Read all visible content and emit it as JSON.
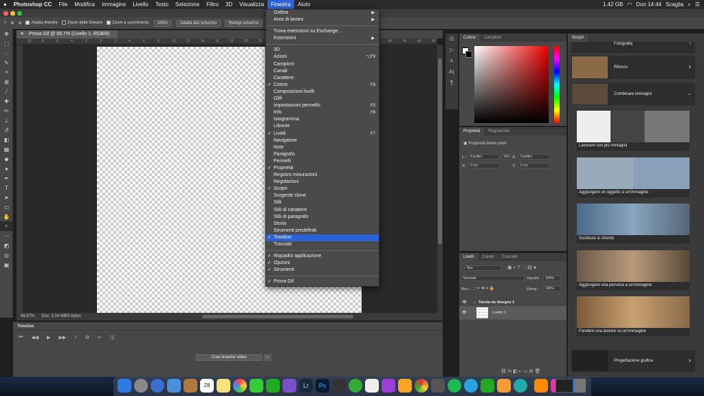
{
  "menubar": {
    "apple": "",
    "items": [
      "Photoshop CC",
      "File",
      "Modifica",
      "Immagine",
      "Livello",
      "Testo",
      "Selezione",
      "Filtro",
      "3D",
      "Visualizza",
      "Finestra",
      "Aiuto"
    ],
    "active": "Finestra",
    "memory": "1.42 GB",
    "clock": "Don 14:44",
    "user": "Scaglia"
  },
  "options": {
    "fit_windows": "Adatta finestre",
    "zoom_all": "Zoom delle finestre",
    "scrubby_zoom": "Zoom a scorrimento",
    "zoom_value": "100%",
    "fit_screen": "Adatta allo schermo",
    "fill_screen": "Riempi schermo"
  },
  "document": {
    "tab": "Prova Gif @ 66,7% (Livello 1, RGB/8)",
    "status_zoom": "66,67%",
    "status_doc": "Doc: 3,34 MB/0 bytes",
    "ruler": [
      "10",
      "8",
      "6",
      "4",
      "2",
      "0",
      "2",
      "4",
      "6",
      "8",
      "10",
      "12",
      "14",
      "16",
      "18",
      "20",
      "22",
      "24",
      "26",
      "28",
      "30",
      "32",
      "34",
      "36",
      "38",
      "40",
      "42",
      "44",
      "46"
    ]
  },
  "timeline": {
    "title": "Timeline",
    "create_button": "Crea timeline video"
  },
  "color_panel": {
    "tabs": [
      "Colore",
      "Campioni"
    ]
  },
  "properties_panel": {
    "tabs": [
      "Proprietà",
      "Regolazioni"
    ],
    "heading": "Proprietà livello pixel",
    "w_label": "L:",
    "w_value": "0 pollici",
    "link": "GO",
    "h_label": "A:",
    "h_value": "0 pollici",
    "x_label": "X:",
    "x_value": "0 cm",
    "y_label": "Y:",
    "y_value": "0 cm"
  },
  "layers_panel": {
    "tabs": [
      "Livelli",
      "Canali",
      "Tracciati"
    ],
    "filter": "Tipo",
    "blend_mode": "Normale",
    "opacity_label": "Opacità:",
    "opacity": "100%",
    "lock_label": "Bloc.:",
    "fill_label": "Riemp.:",
    "fill": "100%",
    "layers": [
      "Tavola da disegno 1",
      "Livello 1"
    ]
  },
  "scopri": {
    "title": "Scopri",
    "items": [
      "Fotografia",
      "Ritocco",
      "Combinare immagini"
    ],
    "cards": [
      "Lavorare con più immagini",
      "Aggiungere un oggetto a un'immagine",
      "Sostituire lo sfondo",
      "Aggiungere una persona a un'immagine",
      "Fondere una texture su un'immagine"
    ],
    "footer": "Progettazione grafica"
  },
  "menu": {
    "items": [
      {
        "label": "Ordina",
        "arrow": "▶"
      },
      {
        "label": "Area di lavoro",
        "arrow": "▶"
      },
      {
        "sep": true
      },
      {
        "label": "Trova estensioni su Exchange..."
      },
      {
        "label": "Estensioni",
        "arrow": "▶"
      },
      {
        "sep": true
      },
      {
        "label": "3D"
      },
      {
        "label": "Azioni",
        "sc": "⌥F9"
      },
      {
        "label": "Campioni"
      },
      {
        "label": "Canali"
      },
      {
        "label": "Carattere"
      },
      {
        "label": "Colore",
        "check": true,
        "sc": "F6"
      },
      {
        "label": "Composizioni livelli"
      },
      {
        "label": "Glifi"
      },
      {
        "label": "Impostazioni pennello",
        "sc": "F5"
      },
      {
        "label": "Info",
        "sc": "F8"
      },
      {
        "label": "Istogramma"
      },
      {
        "label": "Librerie"
      },
      {
        "label": "Livelli",
        "check": true,
        "sc": "F7"
      },
      {
        "label": "Navigatore"
      },
      {
        "label": "Note"
      },
      {
        "label": "Paragrafo"
      },
      {
        "label": "Pennelli"
      },
      {
        "label": "Proprietà",
        "check": true
      },
      {
        "label": "Registro misurazioni"
      },
      {
        "label": "Regolazioni"
      },
      {
        "label": "Scopri",
        "check": true
      },
      {
        "label": "Sorgente clone"
      },
      {
        "label": "Stili"
      },
      {
        "label": "Stili di carattere"
      },
      {
        "label": "Stili di paragrafo"
      },
      {
        "label": "Storia"
      },
      {
        "label": "Strumenti predefiniti"
      },
      {
        "label": "Timeline",
        "check": true,
        "hl": true
      },
      {
        "label": "Tracciati"
      },
      {
        "sep": true
      },
      {
        "label": "Riquadro applicazione",
        "check": true
      },
      {
        "label": "Opzioni",
        "check": true
      },
      {
        "label": "Strumenti",
        "check": true
      },
      {
        "sep": true
      },
      {
        "label": "Prova Gif",
        "check": true
      }
    ]
  },
  "dock": {
    "calendar_day": "28",
    "lr": "Lr",
    "ps": "Ps"
  },
  "colors": {
    "accent": "#2b63d6",
    "panel": "#474747",
    "menu": "#4a4a4a"
  }
}
